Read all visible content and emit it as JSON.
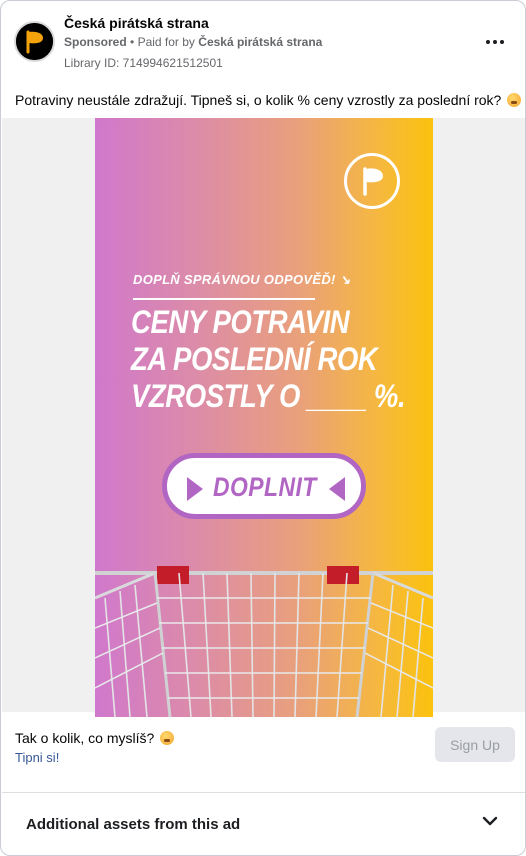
{
  "header": {
    "page_name": "Česká pirátská strana",
    "sponsored": "Sponsored",
    "separator": "•",
    "paid_for_prefix": "Paid for by",
    "paid_for_by": "Česká pirátská strana",
    "library_id": "Library ID: 714994621512501"
  },
  "ad": {
    "body_text": "Potraviny neustále zdražují. Tipneš si, o kolik % ceny vzrostly za poslední rok?",
    "creative": {
      "prompt": "DOPLŇ SPRÁVNOU ODPOVĚĎ! ↘",
      "headline_lines": [
        "CENY POTRAVIN",
        "ZA POSLEDNÍ ROK",
        "VZROSTLY O ____ %."
      ],
      "button_label": "DOPLNIT",
      "colors": {
        "gradient_left": "#d078cc",
        "gradient_right": "#fbc20d",
        "accent": "#b266c4"
      }
    },
    "caption": "Tak o kolik, co myslíš?",
    "link_text": "Tipni si!",
    "cta_label": "Sign Up"
  },
  "footer": {
    "assets_label": "Additional assets from this ad"
  },
  "icons": {
    "avatar": "pirate-flag-logo",
    "more": "more-horizontal-icon",
    "emoji": "thinking-face-emoji",
    "expand": "chevron-down-icon"
  }
}
